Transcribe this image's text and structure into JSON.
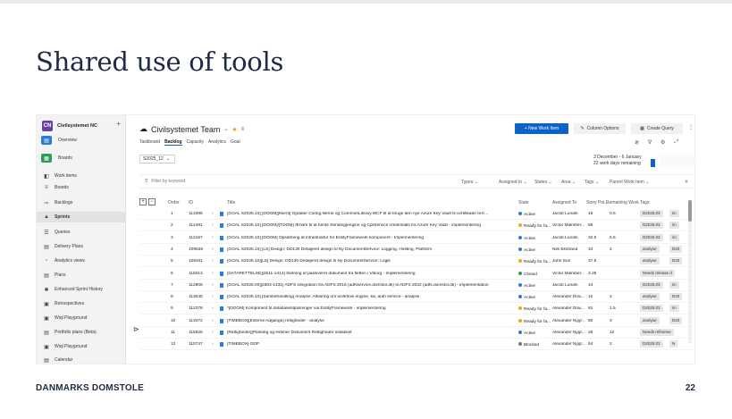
{
  "slide": {
    "title": "Shared use of tools",
    "footer_org": "DANMARKS DOMSTOLE",
    "page_number": "22"
  },
  "sidebar": {
    "project_initials": "CN",
    "project_name": "Civilsystemet NC",
    "add_symbol": "+",
    "items": [
      {
        "label": "Overview",
        "icon": "overview-icon",
        "color": "#2c7bd6"
      },
      {
        "label": "Boards",
        "icon": "boards-icon",
        "color": "#2e9c5a"
      },
      {
        "label": "Work items",
        "icon": "work-items-icon"
      },
      {
        "label": "Boards",
        "icon": "board-icon"
      },
      {
        "label": "Backlogs",
        "icon": "backlogs-icon"
      },
      {
        "label": "Sprints",
        "icon": "sprints-icon"
      },
      {
        "label": "Queries",
        "icon": "queries-icon"
      },
      {
        "label": "Delivery Plans",
        "icon": "delivery-plans-icon"
      },
      {
        "label": "Analytics views",
        "icon": "analytics-icon"
      },
      {
        "label": "Plans",
        "icon": "plans-icon"
      },
      {
        "label": "Enhanced Sprint History",
        "icon": "history-icon"
      },
      {
        "label": "Retrospectives",
        "icon": "retrospectives-icon"
      },
      {
        "label": "Wiql Playground",
        "icon": "wiql-icon"
      },
      {
        "label": "Portfolio plans (Beta)",
        "icon": "portfolio-icon"
      },
      {
        "label": "Wiql Playground",
        "icon": "wiql-icon"
      },
      {
        "label": "Calendar",
        "icon": "calendar-icon"
      }
    ]
  },
  "header": {
    "team_name": "Civilsystemet Team",
    "tabs": [
      "Taskboard",
      "Backlog",
      "Capacity",
      "Analytics",
      "Goal"
    ],
    "active_tab": "Backlog",
    "new_work_item": "New Work Item",
    "column_options": "Column Options",
    "create_query": "Create Query",
    "sprint": "S2025_12",
    "sprint_dates": "3 December - 6 January",
    "sprint_remaining": "22 work days remaining"
  },
  "filter": {
    "placeholder": "Filter by keyword",
    "dropdowns": [
      "Types",
      "Assigned to",
      "States",
      "Area",
      "Tags",
      "Parent Work Item"
    ]
  },
  "table": {
    "columns": [
      "Order",
      "ID",
      "Title",
      "State",
      "Assigned To",
      "Story Poi...",
      "Remaining Work",
      "Tags"
    ],
    "state_colors": {
      "Active": "#2c7bd6",
      "Ready for fa...": "#f2a60c",
      "Closed": "#2e9c5a",
      "Blocked": "#777777"
    },
    "rows": [
      {
        "order": "1",
        "id": "113395",
        "title": "[GOAL S2025.10] [DOOM][Klient] Opdater Config.filerne og CommonLibrary.WCF til at bruge den nye Azure Key Vault til certifikater til K...",
        "state": "Active",
        "assigned": "Jacob Lundin",
        "points": "16",
        "remaining": "0.5",
        "tags": [
          "D2025.03",
          "im"
        ]
      },
      {
        "order": "2",
        "id": "112491",
        "title": "[GOAL S2025.10] [DOOM]/[TDOM] Ændre til at hente Sending|engine og CprService credentials fra Azure Key Vault - implementering",
        "state": "Ready for fa...",
        "assigned": "Victor Malmber...",
        "points": "85",
        "remaining": "",
        "tags": [
          "D2025.03",
          "im"
        ]
      },
      {
        "order": "3",
        "id": "112167",
        "title": "[GOAL S2025.10] [DOOM] Opsætning af infrastruktur for EntityFramework komponent - Implementering",
        "state": "Active",
        "assigned": "Jacob Lundin",
        "points": "32.5",
        "remaining": "6.5",
        "tags": [
          "D2025.03",
          "im"
        ]
      },
      {
        "order": "4",
        "id": "109536",
        "title": "[GOAL S2025.10] [LS] Design: DD130 Detaljeret design til Ny DocumentService: Logging, Hosting, Platform",
        "state": "Active",
        "assigned": "Nils Ekstrand",
        "points": "34",
        "remaining": "2",
        "tags": [
          "analyse",
          "D20"
        ]
      },
      {
        "order": "5",
        "id": "109341",
        "title": "[GOAL S2025.10][LS] Design: DD130 Detaljeret design til Ny DocumentService: Logik",
        "state": "Ready for fa...",
        "assigned": "John Sun",
        "points": "37.5",
        "remaining": "",
        "tags": [
          "analyse",
          "D20"
        ]
      },
      {
        "order": "6",
        "id": "118313",
        "title": "[DATARETTELSE][2511-1414] Sletning af passiveret dokument fra fletten i Viborg - Implementering",
        "state": "Closed",
        "assigned": "Victor Malmber...",
        "points": "3.25",
        "remaining": "",
        "tags": [
          "Needs release d"
        ]
      },
      {
        "order": "7",
        "id": "112805",
        "title": "[GOAL S2025.00][2503-1431] ADFS integration fra ADFS 2016 (adfsservice.domstol.dk) til ADFS 2022 (adfs.domstol.dk) - implementation",
        "state": "Active",
        "assigned": "Jacob Lundin",
        "points": "44",
        "remaining": "",
        "tags": [
          "D2025.03",
          "im"
        ]
      },
      {
        "order": "8",
        "id": "113040",
        "title": "[GOAL S2025.10] [Sambehandling] Analyse: Afklaring om workflow engine, kø, auth service - analyse",
        "state": "Active",
        "assigned": "Alexander Drai...",
        "points": "10",
        "remaining": "2",
        "tags": [
          "analyse",
          "D20"
        ]
      },
      {
        "order": "9",
        "id": "112378",
        "title": "*[DOOM] Komponent til databasetilpasninger via EntityFramework - implementering",
        "state": "Ready for fa...",
        "assigned": "Alexander Drai...",
        "points": "61",
        "remaining": "1.5",
        "tags": [
          "D2025.03",
          "im"
        ]
      },
      {
        "order": "10",
        "id": "113472",
        "title": "[TIMEBOX][Externe Adgange] rettigheder - analyse",
        "state": "Ready for fa...",
        "assigned": "Alexander Nygr...",
        "points": "60",
        "remaining": "3",
        "tags": [
          "analyse",
          "D20"
        ]
      },
      {
        "order": "11",
        "id": "115626",
        "title": "[Rettigheder][Planlæg og estimer Dokument Rettigheder initiativet",
        "state": "Active",
        "assigned": "Alexander Nygr...",
        "points": "28",
        "remaining": "12",
        "tags": [
          "Needs refineme"
        ]
      },
      {
        "order": "12",
        "id": "110747",
        "title": "[TIMEBOX] ODP",
        "state": "Blocked",
        "assigned": "Alexander Nygr...",
        "points": "64",
        "remaining": "2",
        "tags": [
          "D2025.03",
          "N"
        ]
      }
    ]
  }
}
